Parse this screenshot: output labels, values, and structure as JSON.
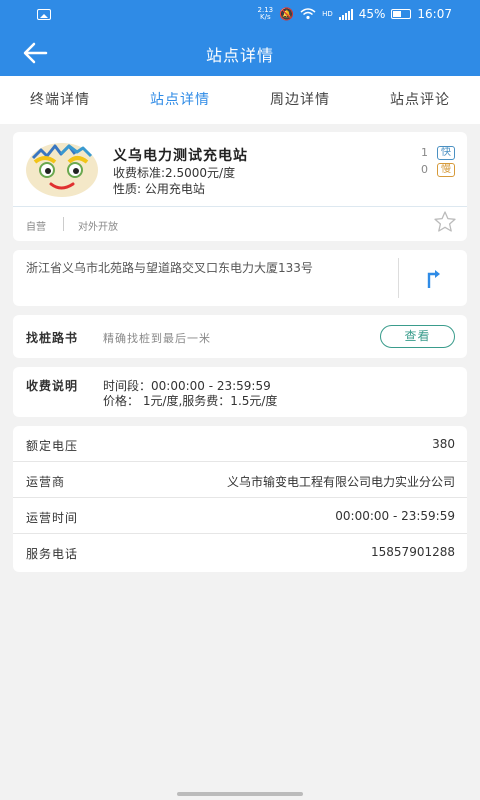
{
  "status_bar": {
    "net_speed_value": "2.13",
    "net_speed_unit": "K/s",
    "hd": "HD",
    "battery": "45%",
    "time": "16:07"
  },
  "header": {
    "title": "站点详情",
    "color": "#2f8be6"
  },
  "tabs": [
    {
      "label": "终端详情",
      "active": false
    },
    {
      "label": "站点详情",
      "active": true
    },
    {
      "label": "周边详情",
      "active": false
    },
    {
      "label": "站点评论",
      "active": false
    }
  ],
  "station": {
    "name": "义乌电力测试充电站",
    "fee_standard": "收费标准:2.5000元/度",
    "nature": "性质: 公用充电站",
    "fast_count": "1",
    "fast_badge": "快",
    "slow_count": "0",
    "slow_badge": "慢",
    "tags": [
      "自营",
      "对外开放"
    ]
  },
  "address": {
    "text": "浙江省义乌市北苑路与望道路交叉口东电力大厦133号"
  },
  "locator": {
    "label": "找桩路书",
    "description": "精确找桩到最后一米",
    "button": "查看"
  },
  "fee": {
    "label": "收费说明",
    "time_period": "时间段：00:00:00 - 23:59:59",
    "price": "价格： 1元/度,服务费：1.5元/度"
  },
  "info": [
    {
      "label": "额定电压",
      "value": "380"
    },
    {
      "label": "运营商",
      "value": "义乌市输变电工程有限公司电力实业分公司"
    },
    {
      "label": "运营时间",
      "value": "00:00:00 - 23:59:59"
    },
    {
      "label": "服务电话",
      "value": "15857901288"
    }
  ]
}
